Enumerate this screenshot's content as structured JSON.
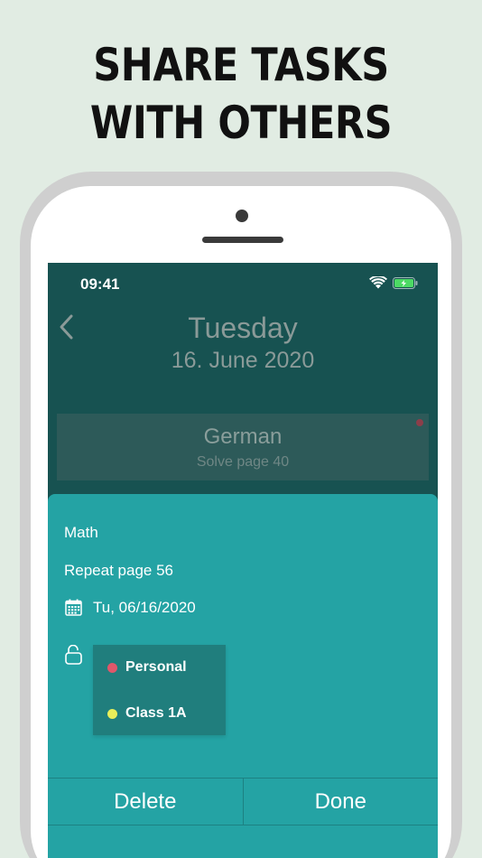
{
  "headline": {
    "line1": "SHARE TASKS",
    "line2": "WITH OTHERS"
  },
  "status_bar": {
    "time": "09:41"
  },
  "header": {
    "day": "Tuesday",
    "date": "16. June 2020"
  },
  "task_card": {
    "subject": "German",
    "note": "Solve page 40",
    "dot_color": "#8c3e4a"
  },
  "detail_sheet": {
    "subject": "Math",
    "note": "Repeat page 56",
    "due_date": "Tu, 06/16/2020",
    "share_options": [
      {
        "label": "Personal",
        "color": "#e0576a"
      },
      {
        "label": "Class 1A",
        "color": "#e8ee5a"
      }
    ]
  },
  "actions": {
    "delete_label": "Delete",
    "done_label": "Done"
  },
  "colors": {
    "background": "#e1ece3",
    "app_dark": "#175251",
    "sheet": "#24a3a4",
    "battery": "#4cd964"
  }
}
